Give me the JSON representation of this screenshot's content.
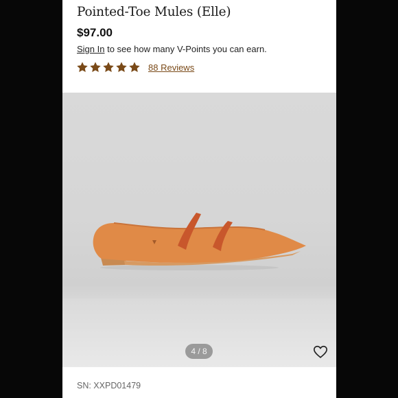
{
  "product": {
    "title": "Pointed-Toe Mules (Elle)",
    "price": "$97.00",
    "signin_link": "Sign In",
    "points_text": " to see how many V-Points you can earn.",
    "rating_stars": 5,
    "reviews_label": "88 Reviews",
    "sku": "SN: XXPD01479"
  },
  "gallery": {
    "pager": "4 / 8"
  },
  "colors": {
    "star": "#7a4a18",
    "shoe_body": "#e08a47",
    "shoe_strap": "#c8572c",
    "sole": "#c88a52"
  }
}
